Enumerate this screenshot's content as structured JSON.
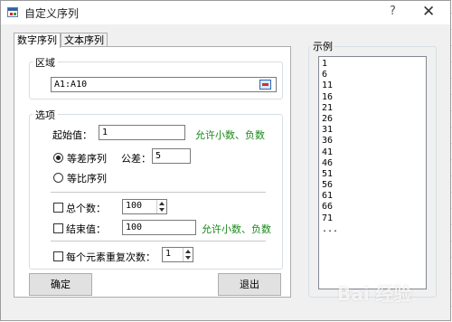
{
  "window": {
    "title": "自定义序列",
    "help_label": "?",
    "close_label": "✕"
  },
  "tabs": [
    {
      "label": "数字序列",
      "active": true
    },
    {
      "label": "文本序列",
      "active": false
    }
  ],
  "area_group": {
    "label": "区域",
    "range_value": "A1:A10"
  },
  "options_group": {
    "label": "选项",
    "start_label": "起始值：",
    "start_value": "1",
    "start_hint": "允许小数、负数",
    "arith_label": "等差序列",
    "diff_label": "公差：",
    "diff_value": "5",
    "geom_label": "等比序列",
    "total_label": "总个数：",
    "total_value": "100",
    "end_label": "结束值：",
    "end_value": "100",
    "end_hint": "允许小数、负数",
    "repeat_label": "每个元素重复次数：",
    "repeat_value": "1"
  },
  "buttons": {
    "ok_label": "确定",
    "exit_label": "退出"
  },
  "example": {
    "label": "示例",
    "items": [
      "1",
      "6",
      "11",
      "16",
      "21",
      "26",
      "31",
      "36",
      "41",
      "46",
      "51",
      "56",
      "61",
      "66",
      "71",
      "..."
    ]
  },
  "watermark": "Bai 经验"
}
